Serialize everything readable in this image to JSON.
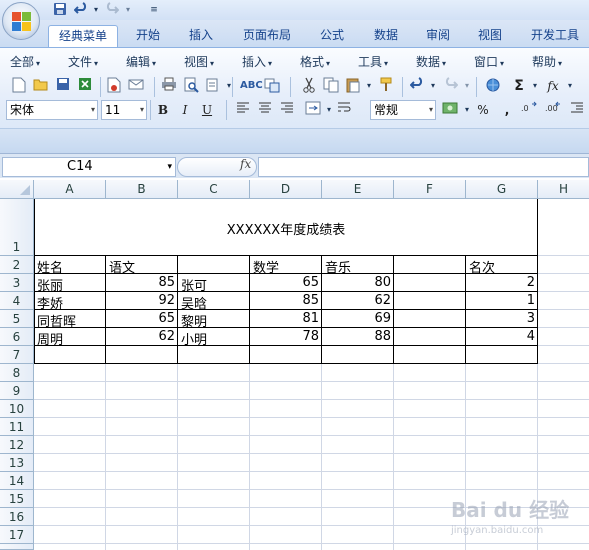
{
  "quick_access": {
    "save_icon": "save-icon",
    "undo_icon": "undo-icon",
    "redo_icon": "redo-icon",
    "customize_icon": "customize-qat-icon"
  },
  "tabs": [
    "经典菜单",
    "开始",
    "插入",
    "页面布局",
    "公式",
    "数据",
    "审阅",
    "视图",
    "开发工具"
  ],
  "active_tab": "经典菜单",
  "menus": [
    "全部",
    "文件",
    "编辑",
    "视图",
    "插入",
    "格式",
    "工具",
    "数据",
    "窗口",
    "帮助"
  ],
  "toolbar": {
    "font_name": "宋体",
    "font_size": "11",
    "bold": "B",
    "italic": "I",
    "underline": "U",
    "number_format": "常规",
    "percent": "%",
    "comma": ",",
    "sum": "Σ",
    "fx": "fx"
  },
  "formula_bar": {
    "name_box": "C14",
    "fx_label": "fx",
    "formula": ""
  },
  "sheet": {
    "columns": [
      "A",
      "B",
      "C",
      "D",
      "E",
      "F",
      "G",
      "H"
    ],
    "rows": [
      "1",
      "2",
      "3",
      "4",
      "5",
      "6",
      "7",
      "8",
      "9",
      "10",
      "11",
      "12",
      "13",
      "14",
      "15",
      "16",
      "17"
    ],
    "title": "XXXXXX年度成绩表",
    "header": {
      "A": "姓名",
      "B": "语文",
      "D": "数学",
      "E": "音乐",
      "G": "名次"
    },
    "data_rows": [
      {
        "name": "张丽",
        "chinese": "85",
        "name2": "张可",
        "math": "65",
        "music": "80",
        "rank": "2"
      },
      {
        "name": "李娇",
        "chinese": "92",
        "name2": "吴晗",
        "math": "85",
        "music": "62",
        "rank": "1"
      },
      {
        "name": "同哲晖",
        "chinese": "65",
        "name2": "黎明",
        "math": "81",
        "music": "69",
        "rank": "3"
      },
      {
        "name": "周明",
        "chinese": "62",
        "name2": "小明",
        "math": "78",
        "music": "88",
        "rank": "4"
      }
    ]
  },
  "watermark": {
    "text": "Bai du 经验",
    "url": "jingyan.baidu.com"
  }
}
